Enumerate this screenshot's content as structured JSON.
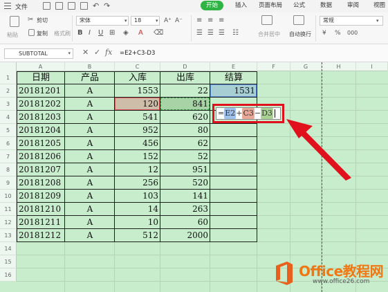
{
  "menubar": {
    "file_label": "文件",
    "tabs": [
      {
        "label": "开始",
        "active": true
      },
      {
        "label": "插入",
        "active": false
      },
      {
        "label": "页面布局",
        "active": false
      },
      {
        "label": "公式",
        "active": false
      },
      {
        "label": "数据",
        "active": false
      },
      {
        "label": "审阅",
        "active": false
      },
      {
        "label": "视图",
        "active": false
      }
    ]
  },
  "ribbon": {
    "cut_label": "剪切",
    "copy_label": "复制",
    "paste_label": "粘贴",
    "format_painter_label": "格式刷",
    "font_name": "宋体",
    "font_size": "18",
    "merge_label": "合并居中",
    "wrap_label": "自动换行",
    "number_format": "常规",
    "accent_color": "#2fb343"
  },
  "formula_bar": {
    "name_box": "SUBTOTAL",
    "cancel_glyph": "✕",
    "confirm_glyph": "✓",
    "fx_label": "fx",
    "formula": "=E2+C3-D3"
  },
  "columns": [
    "A",
    "B",
    "C",
    "D",
    "E",
    "F",
    "G",
    "H",
    "I"
  ],
  "rows": [
    "1",
    "2",
    "3",
    "4",
    "5",
    "6",
    "7",
    "8",
    "9",
    "10",
    "11",
    "12",
    "13",
    "14",
    "15",
    "16"
  ],
  "table": {
    "headers": [
      "日期",
      "产品",
      "入库",
      "出库",
      "结算"
    ],
    "records": [
      {
        "date": "20181201",
        "product": "A",
        "in": "1553",
        "out": "22",
        "settle": "1531"
      },
      {
        "date": "20181202",
        "product": "A",
        "in": "120",
        "out": "841",
        "settle": ""
      },
      {
        "date": "20181203",
        "product": "A",
        "in": "541",
        "out": "620",
        "settle": ""
      },
      {
        "date": "20181204",
        "product": "A",
        "in": "952",
        "out": "80",
        "settle": ""
      },
      {
        "date": "20181205",
        "product": "A",
        "in": "456",
        "out": "62",
        "settle": ""
      },
      {
        "date": "20181206",
        "product": "A",
        "in": "152",
        "out": "52",
        "settle": ""
      },
      {
        "date": "20181207",
        "product": "A",
        "in": "12",
        "out": "951",
        "settle": ""
      },
      {
        "date": "20181208",
        "product": "A",
        "in": "256",
        "out": "520",
        "settle": ""
      },
      {
        "date": "20181209",
        "product": "A",
        "in": "103",
        "out": "141",
        "settle": ""
      },
      {
        "date": "20181210",
        "product": "A",
        "in": "14",
        "out": "263",
        "settle": ""
      },
      {
        "date": "20181211",
        "product": "A",
        "in": "10",
        "out": "60",
        "settle": ""
      },
      {
        "date": "20181212",
        "product": "A",
        "in": "512",
        "out": "2000",
        "settle": ""
      }
    ]
  },
  "editor": {
    "eq": "=",
    "ref1": "E2",
    "op1": "+",
    "ref2": "C3",
    "op2": "−",
    "ref3": "D3"
  },
  "watermark": {
    "title": "Office教程网",
    "url": "www.office26.com"
  }
}
